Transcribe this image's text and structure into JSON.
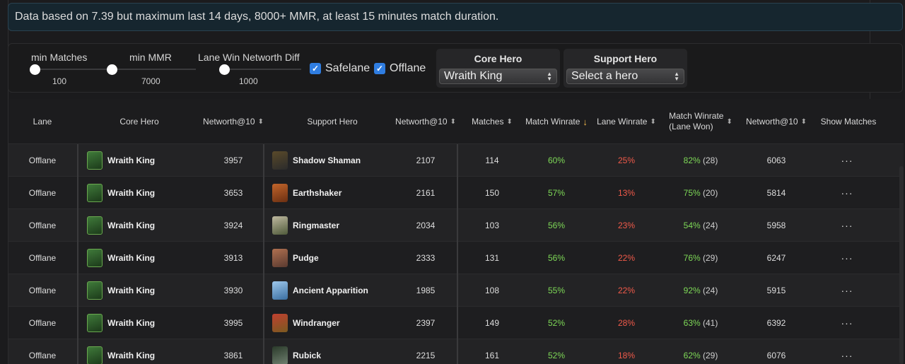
{
  "banner": {
    "text": "Data based on 7.39 but maximum last 14 days, 8000+ MMR, at least 15 minutes match duration."
  },
  "filters": {
    "sliders": [
      {
        "label": "min Matches",
        "value": "100"
      },
      {
        "label": "min MMR",
        "value": "7000"
      },
      {
        "label": "Lane Win Networth Diff",
        "value": "1000"
      }
    ],
    "checkboxes": [
      {
        "label": "Safelane",
        "checked": true
      },
      {
        "label": "Offlane",
        "checked": true
      }
    ],
    "core_hero": {
      "title": "Core Hero",
      "selected": "Wraith King"
    },
    "support_hero": {
      "title": "Support Hero",
      "selected": "Select a hero"
    }
  },
  "table": {
    "headers": {
      "lane": "Lane",
      "core_hero": "Core Hero",
      "core_networth": "Networth@10",
      "support_hero": "Support Hero",
      "support_networth": "Networth@10",
      "matches": "Matches",
      "match_winrate": "Match Winrate",
      "lane_winrate": "Lane Winrate",
      "match_winrate_lane_won_1": "Match Winrate",
      "match_winrate_lane_won_2": "(Lane Won)",
      "networth": "Networth@10",
      "show_matches": "Show Matches"
    },
    "rows": [
      {
        "lane": "Offlane",
        "core": "Wraith King",
        "core_nw": "3957",
        "support": "Shadow Shaman",
        "support_nw": "2107",
        "matches": "114",
        "match_wr": "60%",
        "lane_wr": "25%",
        "wr_lane_won": "82%",
        "wr_lane_won_count": "(28)",
        "networth": "6063",
        "more": "···"
      },
      {
        "lane": "Offlane",
        "core": "Wraith King",
        "core_nw": "3653",
        "support": "Earthshaker",
        "support_nw": "2161",
        "matches": "150",
        "match_wr": "57%",
        "lane_wr": "13%",
        "wr_lane_won": "75%",
        "wr_lane_won_count": "(20)",
        "networth": "5814",
        "more": "···"
      },
      {
        "lane": "Offlane",
        "core": "Wraith King",
        "core_nw": "3924",
        "support": "Ringmaster",
        "support_nw": "2034",
        "matches": "103",
        "match_wr": "56%",
        "lane_wr": "23%",
        "wr_lane_won": "54%",
        "wr_lane_won_count": "(24)",
        "networth": "5958",
        "more": "···"
      },
      {
        "lane": "Offlane",
        "core": "Wraith King",
        "core_nw": "3913",
        "support": "Pudge",
        "support_nw": "2333",
        "matches": "131",
        "match_wr": "56%",
        "lane_wr": "22%",
        "wr_lane_won": "76%",
        "wr_lane_won_count": "(29)",
        "networth": "6247",
        "more": "···"
      },
      {
        "lane": "Offlane",
        "core": "Wraith King",
        "core_nw": "3930",
        "support": "Ancient Apparition",
        "support_nw": "1985",
        "matches": "108",
        "match_wr": "55%",
        "lane_wr": "22%",
        "wr_lane_won": "92%",
        "wr_lane_won_count": "(24)",
        "networth": "5915",
        "more": "···"
      },
      {
        "lane": "Offlane",
        "core": "Wraith King",
        "core_nw": "3995",
        "support": "Windranger",
        "support_nw": "2397",
        "matches": "149",
        "match_wr": "52%",
        "lane_wr": "28%",
        "wr_lane_won": "63%",
        "wr_lane_won_count": "(41)",
        "networth": "6392",
        "more": "···"
      },
      {
        "lane": "Offlane",
        "core": "Wraith King",
        "core_nw": "3861",
        "support": "Rubick",
        "support_nw": "2215",
        "matches": "161",
        "match_wr": "52%",
        "lane_wr": "18%",
        "wr_lane_won": "62%",
        "wr_lane_won_count": "(29)",
        "networth": "6076",
        "more": "···"
      }
    ]
  },
  "colors": {
    "positive": "#7ed957",
    "negative": "#f15a4a",
    "checkbox": "#2f7de1",
    "sort_active": "#f2b84b"
  }
}
